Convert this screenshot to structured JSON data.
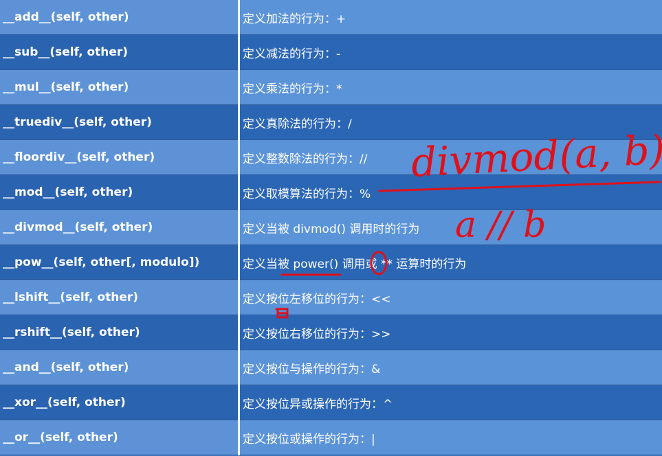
{
  "rows": [
    {
      "method": "__add__(self, other)",
      "desc": "定义加法的行为：+"
    },
    {
      "method": "__sub__(self, other)",
      "desc": "定义减法的行为：-"
    },
    {
      "method": "__mul__(self, other)",
      "desc": "定义乘法的行为：*"
    },
    {
      "method": "__truediv__(self, other)",
      "desc": "定义真除法的行为：/"
    },
    {
      "method": "__floordiv__(self, other)",
      "desc": "定义整数除法的行为：//"
    },
    {
      "method": "__mod__(self, other)",
      "desc": "定义取模算法的行为：%"
    },
    {
      "method": "__divmod__(self, other)",
      "desc": "定义当被 divmod() 调用时的行为"
    },
    {
      "method": "__pow__(self, other[, modulo])",
      "desc": "定义当被 power() 调用或 ** 运算时的行为"
    },
    {
      "method": "__lshift__(self, other)",
      "desc": "定义按位左移位的行为：<<"
    },
    {
      "method": "__rshift__(self, other)",
      "desc": "定义按位右移位的行为：>>"
    },
    {
      "method": "__and__(self, other)",
      "desc": "定义按位与操作的行为：&"
    },
    {
      "method": "__xor__(self, other)",
      "desc": "定义按位异或操作的行为：^"
    },
    {
      "method": "__or__(self, other)",
      "desc": "定义按位或操作的行为：|"
    }
  ],
  "annotations": {
    "numerator": "divmod(a, b)",
    "denominator": "a // b",
    "ink_color": "#e0101a"
  }
}
